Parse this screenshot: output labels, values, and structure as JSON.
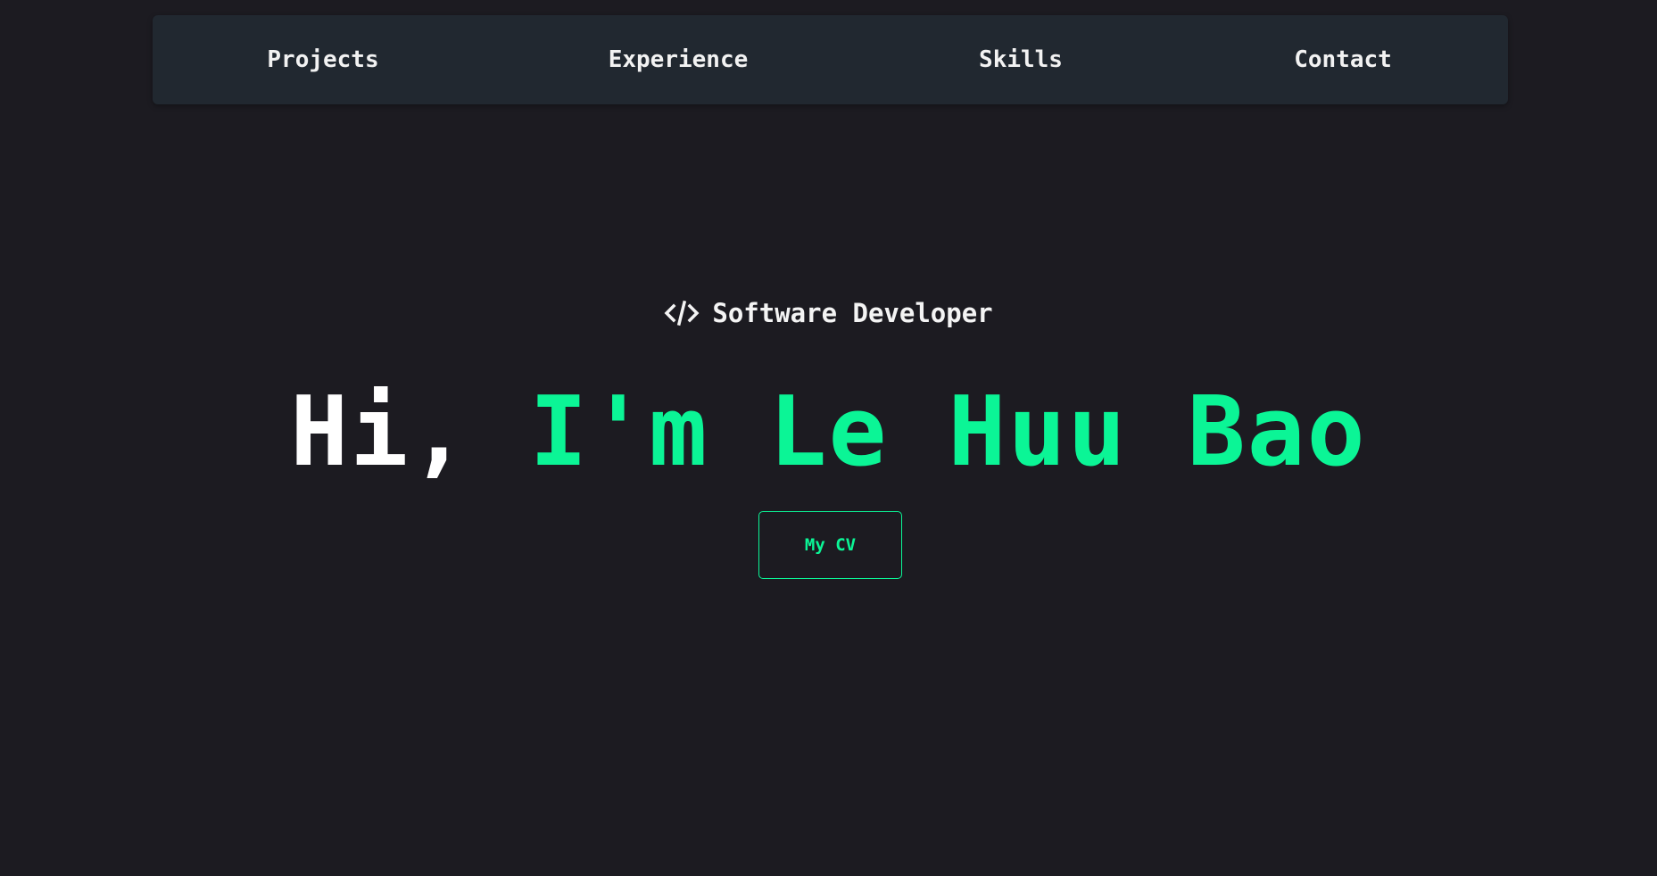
{
  "nav": {
    "items": [
      {
        "label": "Projects"
      },
      {
        "label": "Experience"
      },
      {
        "label": "Skills"
      },
      {
        "label": "Contact"
      }
    ]
  },
  "hero": {
    "role_icon": "code-icon",
    "role": "Software Developer",
    "greeting": "Hi,",
    "name": "I'm Le Huu Bao",
    "cv_button_label": "My CV"
  },
  "colors": {
    "background": "#1c1b21",
    "navbar": "#212830",
    "accent": "#0bf596",
    "text": "#ffffff"
  }
}
